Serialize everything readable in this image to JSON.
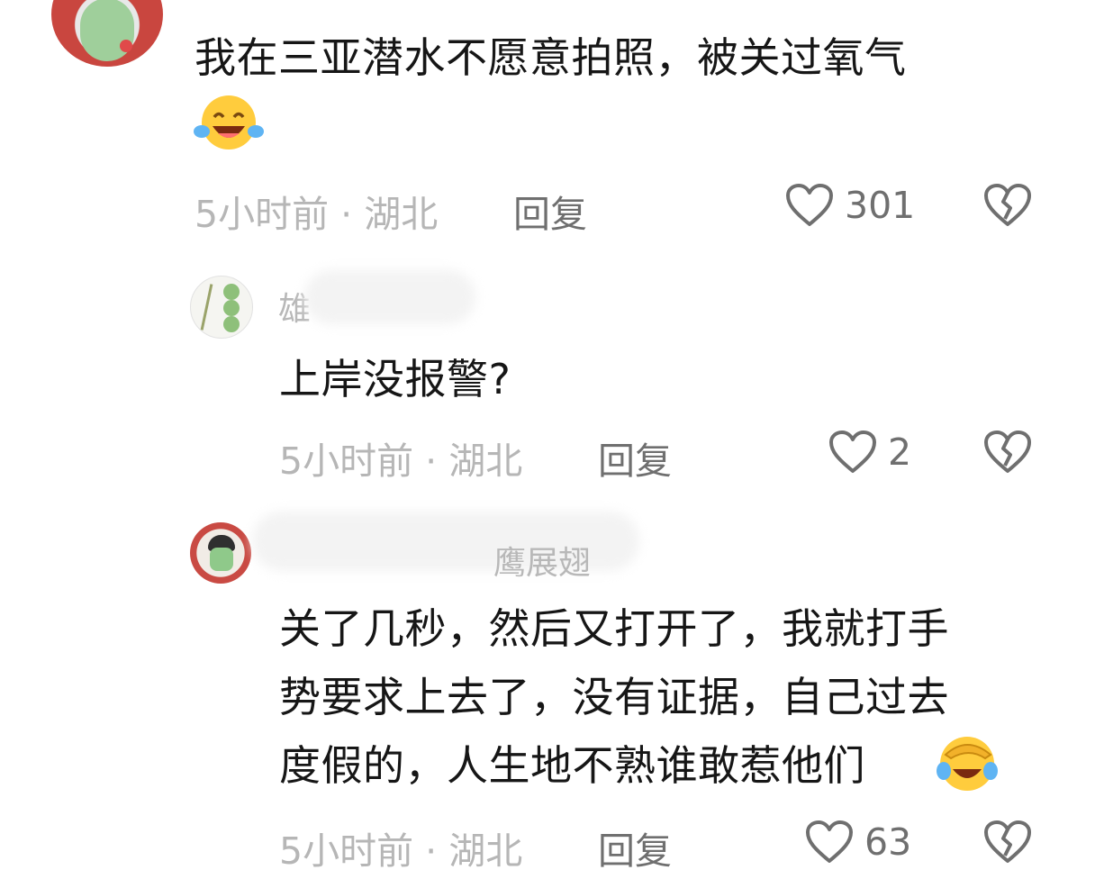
{
  "colors": {
    "text": "#161616",
    "meta": "#b6b6b6",
    "action": "#6f6f6f",
    "icon": "#6f6f6f"
  },
  "comments": [
    {
      "text": "我在三亚潜水不愿意拍照，被关过氧气",
      "emoji": "laughing-tears-emoji",
      "time": "5小时前",
      "location": "湖北",
      "reply": "回复",
      "likes": "301"
    },
    {
      "username": "雄",
      "text": "上岸没报警?",
      "time": "5小时前",
      "location": "湖北",
      "reply": "回复",
      "likes": "2"
    },
    {
      "username": "鹰展翅",
      "text_lines": [
        "关了几秒，然后又打开了，我就打手",
        "势要求上去了，没有证据，自己过去",
        "度假的，人生地不熟谁敢惹他们"
      ],
      "emoji": "facepalm-crying-emoji",
      "time": "5小时前",
      "location": "湖北",
      "reply": "回复",
      "likes": "63"
    }
  ],
  "icons": {
    "like": "heart-outline-icon",
    "dislike": "broken-heart-icon"
  },
  "separator": "·"
}
